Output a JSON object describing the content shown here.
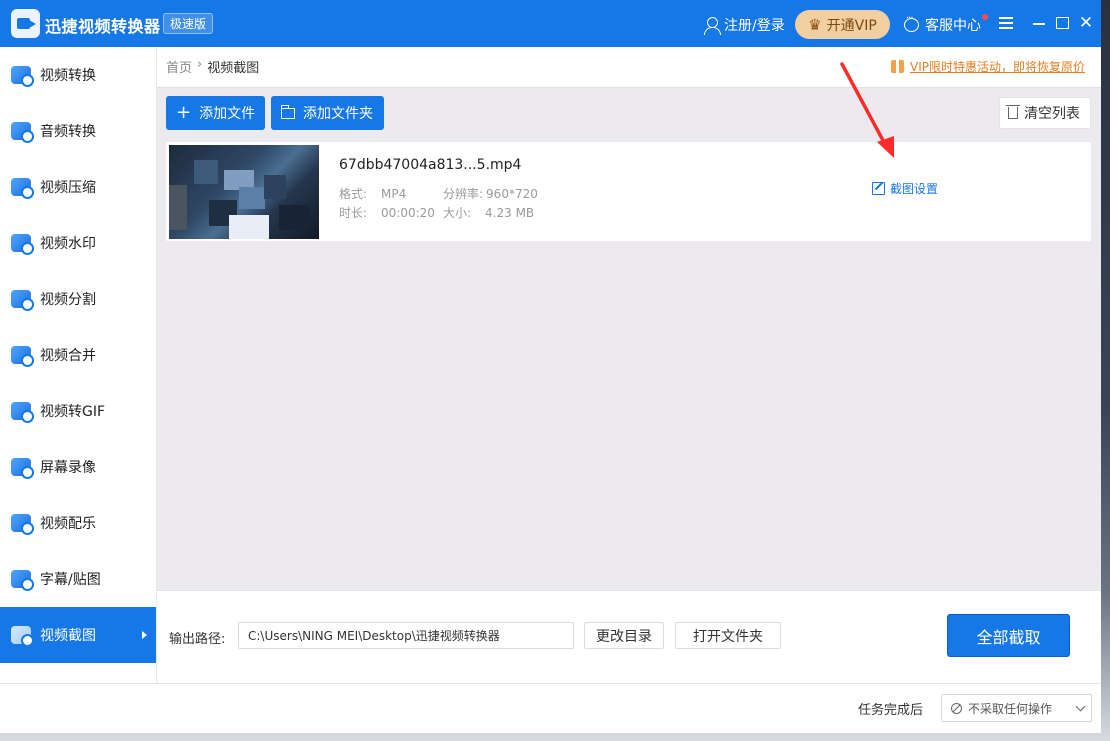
{
  "titlebar": {
    "app_title": "迅捷视频转换器",
    "edition": "极速版",
    "login": "注册/登录",
    "vip": "开通VIP",
    "service": "客服中心"
  },
  "sidebar": {
    "items": [
      {
        "label": "视频转换",
        "icon": "video-convert-icon"
      },
      {
        "label": "音频转换",
        "icon": "audio-convert-icon"
      },
      {
        "label": "视频压缩",
        "icon": "video-compress-icon"
      },
      {
        "label": "视频水印",
        "icon": "video-watermark-icon"
      },
      {
        "label": "视频分割",
        "icon": "video-split-icon"
      },
      {
        "label": "视频合并",
        "icon": "video-merge-icon"
      },
      {
        "label": "视频转GIF",
        "icon": "video-gif-icon"
      },
      {
        "label": "屏幕录像",
        "icon": "screen-record-icon"
      },
      {
        "label": "视频配乐",
        "icon": "video-music-icon"
      },
      {
        "label": "字幕/贴图",
        "icon": "subtitle-icon"
      },
      {
        "label": "视频截图",
        "icon": "video-screenshot-icon",
        "active": true
      }
    ]
  },
  "breadcrumb": {
    "home": "首页",
    "separator": "›",
    "current": "视频截图"
  },
  "promo": "VIP限时特惠活动，即将恢复原价",
  "toolbar": {
    "add_file": "添加文件",
    "add_folder": "添加文件夹",
    "clear_list": "清空列表"
  },
  "file": {
    "name": "67dbb47004a813...5.mp4",
    "format_label": "格式:",
    "format": "MP4",
    "resolution_label": "分辨率:",
    "resolution": "960*720",
    "duration_label": "时长:",
    "duration": "00:00:20",
    "size_label": "大小:",
    "size": "4.23 MB",
    "settings": "截图设置"
  },
  "output": {
    "label": "输出路径:",
    "path": "C:\\Users\\NING MEI\\Desktop\\迅捷视频转换器",
    "change_dir": "更改目录",
    "open_folder": "打开文件夹",
    "capture_all": "全部截取"
  },
  "footer": {
    "after_label": "任务完成后",
    "after_value": "不采取任何操作"
  },
  "colors": {
    "accent": "#1677e6",
    "vip": "#f2cfa0",
    "promo": "#e67e22",
    "arrow": "#ff2a2a"
  }
}
